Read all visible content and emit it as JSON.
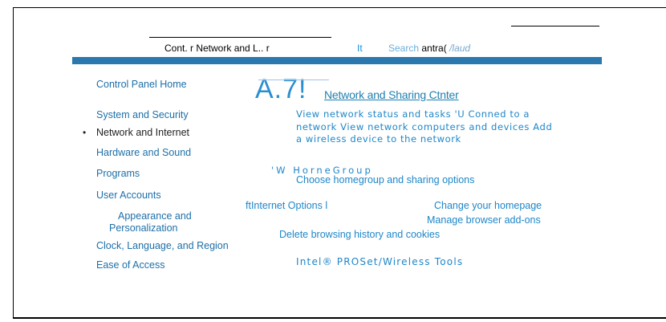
{
  "header": {
    "breadcrumb": "Cont. r Network and L.. r",
    "separator": "It",
    "search_label": "Search",
    "search_value": "antra(",
    "search_placeholder": "/laud"
  },
  "sidebar": {
    "home": "Control Panel Home",
    "items": [
      "System and Security",
      "Network and Internet",
      "Hardware and Sound",
      "Programs",
      "User Accounts",
      "Appearance and",
      "Personalization",
      "Clock, Language, and Region",
      "Ease of Access"
    ],
    "bullet": "•"
  },
  "main": {
    "icon_text": "A.7!",
    "nsc_title": "Network and Sharing Ctnter",
    "nsc_line1": "View network status and tasks 'U Conned to a",
    "nsc_line2": "network View network computers and devices Add",
    "nsc_line3": "a wireless device to the network",
    "homegroup_title": "'W HorneGroup",
    "homegroup_link": "Choose homegroup and sharing options",
    "inet_title": "ftInternet Options l",
    "inet_homepage": "Change your homepage",
    "inet_addons": "Manage browser add-ons",
    "inet_history": "Delete browsing history and cookies",
    "intel": "Intel® PROSet/Wireless Tools"
  }
}
